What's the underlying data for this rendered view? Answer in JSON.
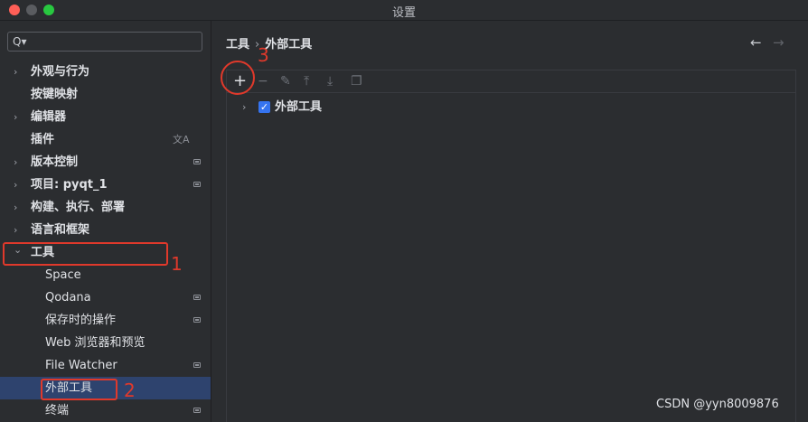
{
  "window": {
    "title": "设置"
  },
  "search": {
    "placeholder": "",
    "icon": "search-icon"
  },
  "sidebar": {
    "items": [
      {
        "label": "外观与行为",
        "expandable": true,
        "expanded": false,
        "badge": false
      },
      {
        "label": "按键映射",
        "expandable": false,
        "badge": false
      },
      {
        "label": "编辑器",
        "expandable": true,
        "expanded": false,
        "badge": false
      },
      {
        "label": "插件",
        "expandable": false,
        "badge": false,
        "icon": "translate-icon"
      },
      {
        "label": "版本控制",
        "expandable": true,
        "expanded": false,
        "badge": true
      },
      {
        "label": "项目: pyqt_1",
        "expandable": true,
        "expanded": false,
        "badge": true
      },
      {
        "label": "构建、执行、部署",
        "expandable": true,
        "expanded": false,
        "badge": false
      },
      {
        "label": "语言和框架",
        "expandable": true,
        "expanded": false,
        "badge": false
      },
      {
        "label": "工具",
        "expandable": true,
        "expanded": true,
        "badge": false
      },
      {
        "label": "Space",
        "child": true,
        "badge": false
      },
      {
        "label": "Qodana",
        "child": true,
        "badge": true
      },
      {
        "label": "保存时的操作",
        "child": true,
        "badge": true
      },
      {
        "label": "Web 浏览器和预览",
        "child": true,
        "badge": false
      },
      {
        "label": "File Watcher",
        "child": true,
        "badge": true
      },
      {
        "label": "外部工具",
        "child": true,
        "badge": false,
        "selected": true
      },
      {
        "label": "终端",
        "child": true,
        "badge": true
      }
    ]
  },
  "breadcrumb": {
    "parent": "工具",
    "separator": "›",
    "current": "外部工具"
  },
  "nav": {
    "back": "←",
    "forward": "→"
  },
  "toolbar": {
    "add": "+",
    "remove": "−",
    "edit": "✎",
    "move_up": "⤒",
    "move_down": "⤓",
    "copy": "❐"
  },
  "tools": [
    {
      "label": "外部工具",
      "checked": true,
      "check_glyph": "✓",
      "chevron": "›"
    }
  ],
  "annotations": {
    "mark1": "1",
    "mark2": "2",
    "mark3": "3"
  },
  "watermark": "CSDN @yyn8009876",
  "colors": {
    "background": "#2b2d30",
    "selection": "#2e436e",
    "accent": "#3574f0",
    "annotation": "#e0392b"
  }
}
